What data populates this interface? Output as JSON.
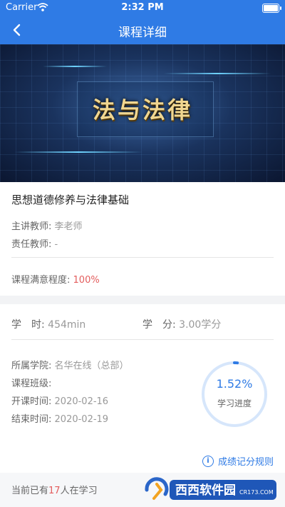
{
  "status_bar": {
    "carrier": "Carrier",
    "time": "2:32 PM"
  },
  "nav": {
    "title": "课程详细",
    "back_icon": "chevron-left-icon"
  },
  "banner": {
    "title": "法与法律"
  },
  "course": {
    "name": "思想道德修养与法律基础",
    "lecturer_label": "主讲教师:",
    "lecturer": "李老师",
    "responsible_label": "责任教师:",
    "responsible": "-",
    "satisfaction_label": "课程满意程度:",
    "satisfaction": "100%"
  },
  "credits": {
    "hours_label": "学　时:",
    "hours": "454min",
    "credit_label": "学　分:",
    "credit": "3.00学分"
  },
  "details": {
    "college_label": "所属学院:",
    "college": "名华在线（总部）",
    "class_label": "课程班级:",
    "class": "",
    "start_label": "开课时间:",
    "start": "2020-02-16",
    "end_label": "结束时间:",
    "end": "2020-02-19"
  },
  "progress": {
    "percent_text": "1.52%",
    "value": 0.0152,
    "label": "学习进度"
  },
  "rules_link": {
    "label": "成绩记分规则",
    "icon": "info-icon"
  },
  "footer": {
    "prefix": "当前已有",
    "count": "17",
    "suffix": "人在学习"
  },
  "watermark": {
    "text_main": "西西软件园",
    "text_sub": "CR173.COM"
  },
  "colors": {
    "primary": "#2f7be5",
    "accent_red": "#e35d5d"
  }
}
